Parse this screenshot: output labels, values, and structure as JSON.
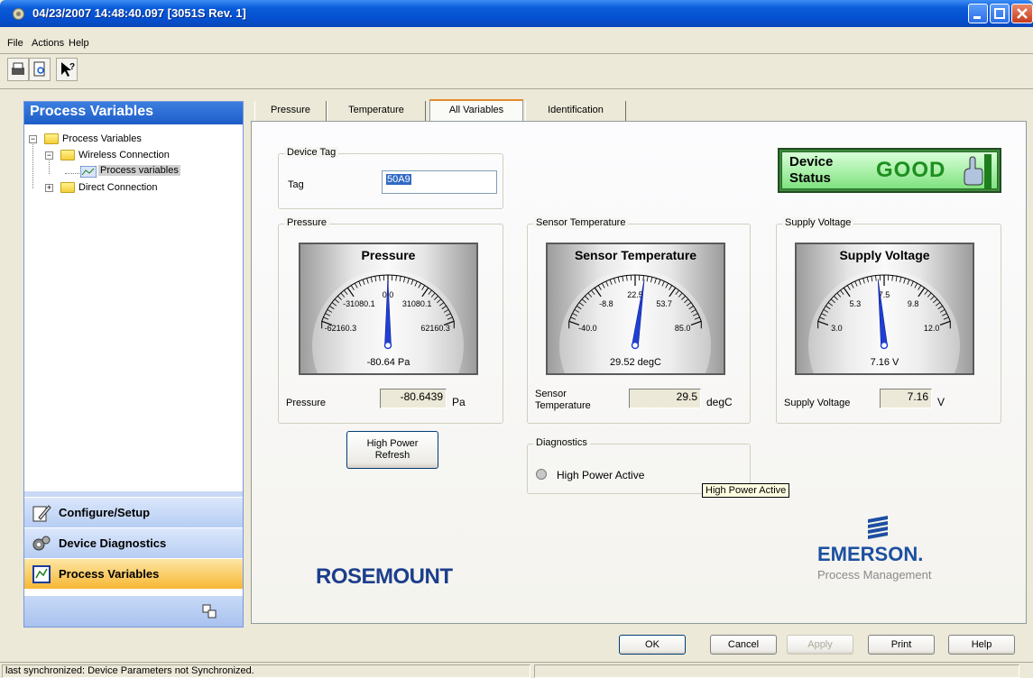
{
  "window": {
    "title": "04/23/2007 14:48:40.097 [3051S Rev. 1]"
  },
  "menu": [
    "File",
    "Actions",
    "Help"
  ],
  "sidebar": {
    "header": "Process Variables",
    "tree": [
      {
        "label": "Process Variables"
      },
      {
        "label": "Wireless Connection"
      },
      {
        "label": "Process variables"
      },
      {
        "label": "Direct Connection"
      }
    ],
    "nav": [
      {
        "label": "Configure/Setup"
      },
      {
        "label": "Device Diagnostics"
      },
      {
        "label": "Process Variables"
      }
    ]
  },
  "tabs": [
    "Pressure",
    "Temperature",
    "All Variables",
    "Identification"
  ],
  "device_tag": {
    "group_label": "Device Tag",
    "label": "Tag",
    "value": "50A9"
  },
  "device_status": {
    "line1": "Device",
    "line2": "Status",
    "value": "GOOD"
  },
  "pressure": {
    "group_label": "Pressure",
    "gauge_title": "Pressure",
    "ticks": [
      "-62160.3",
      "-31080.1",
      "0.0",
      "31080.1",
      "62160.3"
    ],
    "gauge_value": "-80.64 Pa",
    "range": [
      -62160.3,
      62160.3
    ],
    "reading": -80.6439,
    "field_label": "Pressure",
    "field_value": "-80.6439",
    "unit": "Pa"
  },
  "temperature": {
    "group_label": "Sensor Temperature",
    "gauge_title": "Sensor Temperature",
    "ticks": [
      "-40.0",
      "-8.8",
      "22.5",
      "53.7",
      "85.0"
    ],
    "gauge_value": "29.52 degC",
    "range": [
      -40.0,
      85.0
    ],
    "reading": 29.52,
    "field_label_1": "Sensor",
    "field_label_2": "Temperature",
    "field_value": "29.5",
    "unit": "degC"
  },
  "voltage": {
    "group_label": "Supply Voltage",
    "gauge_title": "Supply Voltage",
    "ticks": [
      "3.0",
      "5.3",
      "7.5",
      "9.8",
      "12.0"
    ],
    "gauge_value": "7.16 V",
    "range": [
      3.0,
      12.0
    ],
    "reading": 7.16,
    "field_label": "Supply Voltage",
    "field_value": "7.16",
    "unit": "V"
  },
  "high_power_button": {
    "line1": "High Power",
    "line2": "Refresh"
  },
  "diagnostics": {
    "group_label": "Diagnostics",
    "item": "High Power Active"
  },
  "tooltip": "High Power Active",
  "logos": {
    "rosemount": "ROSEMOUNT",
    "emerson": "EMERSON.",
    "emerson_sub": "Process Management"
  },
  "buttons": {
    "ok": "OK",
    "cancel": "Cancel",
    "apply": "Apply",
    "print": "Print",
    "help": "Help"
  },
  "statusbar": {
    "text": "last synchronized: Device Parameters not Synchronized."
  },
  "colors": {
    "accent": "#0a5bd9",
    "needle": "#1f3fd6",
    "status_good": "#1e8f1e"
  }
}
